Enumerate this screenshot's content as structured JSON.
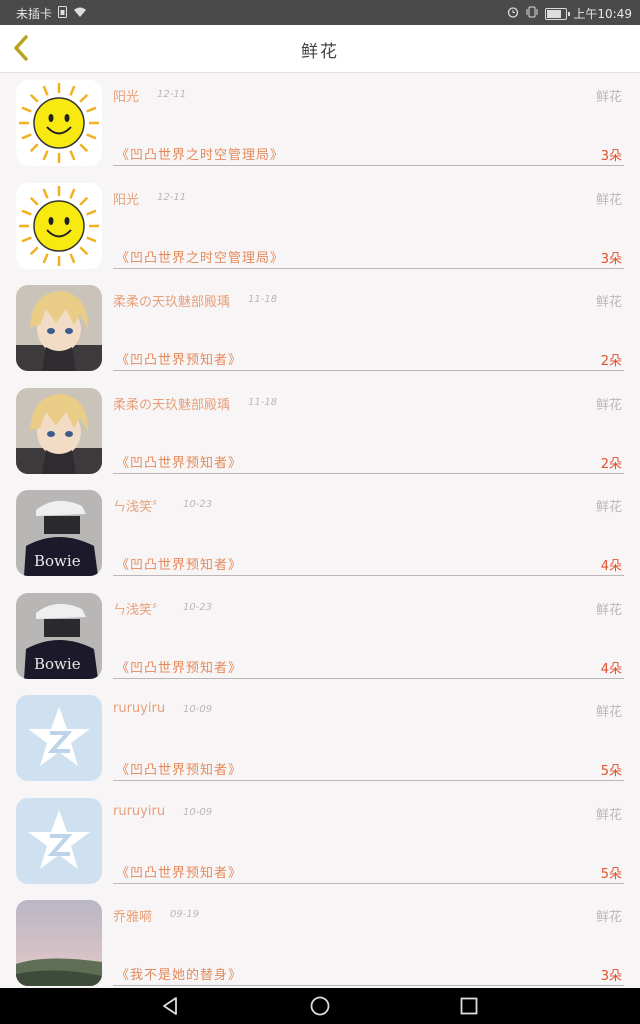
{
  "status_bar": {
    "carrier": "未插卡",
    "time": "上午10:49"
  },
  "header": {
    "title": "鲜花",
    "back_icon": "chevron-left-icon",
    "accent_color": "#b9a21c"
  },
  "colors": {
    "name": "#e8a07a",
    "book": "#e58a5c",
    "count": "#e0532f",
    "muted": "#bdb6b6"
  },
  "items": [
    {
      "name": "阳光",
      "date": "12-11",
      "type": "鲜花",
      "book": "《凹凸世界之时空管理局》",
      "count": "3朵",
      "avatar": "sun"
    },
    {
      "name": "阳光",
      "date": "12-11",
      "type": "鲜花",
      "book": "《凹凸世界之时空管理局》",
      "count": "3朵",
      "avatar": "sun"
    },
    {
      "name": "柔柔の天玖魅部殿瑀",
      "date": "11-18",
      "type": "鲜花",
      "book": "《凹凸世界预知者》",
      "count": "2朵",
      "avatar": "anime-boy"
    },
    {
      "name": "柔柔の天玖魅部殿瑀",
      "date": "11-18",
      "type": "鲜花",
      "book": "《凹凸世界预知者》",
      "count": "2朵",
      "avatar": "anime-boy"
    },
    {
      "name": "ㄣ浅笑〞",
      "date": "10-23",
      "type": "鲜花",
      "book": "《凹凸世界预知者》",
      "count": "4朵",
      "avatar": "cap-person"
    },
    {
      "name": "ㄣ浅笑〞",
      "date": "10-23",
      "type": "鲜花",
      "book": "《凹凸世界预知者》",
      "count": "4朵",
      "avatar": "cap-person"
    },
    {
      "name": "ruruyiru",
      "date": "10-09",
      "type": "鲜花",
      "book": "《凹凸世界预知者》",
      "count": "5朵",
      "avatar": "qq-star"
    },
    {
      "name": "ruruyiru",
      "date": "10-09",
      "type": "鲜花",
      "book": "《凹凸世界预知者》",
      "count": "5朵",
      "avatar": "qq-star"
    },
    {
      "name": "乔雅嗬",
      "date": "09-19",
      "type": "鲜花",
      "book": "《我不是她的替身》",
      "count": "3朵",
      "avatar": "landscape"
    }
  ],
  "nav": {
    "back": "triangle-back-icon",
    "home": "circle-home-icon",
    "recents": "square-recents-icon"
  }
}
